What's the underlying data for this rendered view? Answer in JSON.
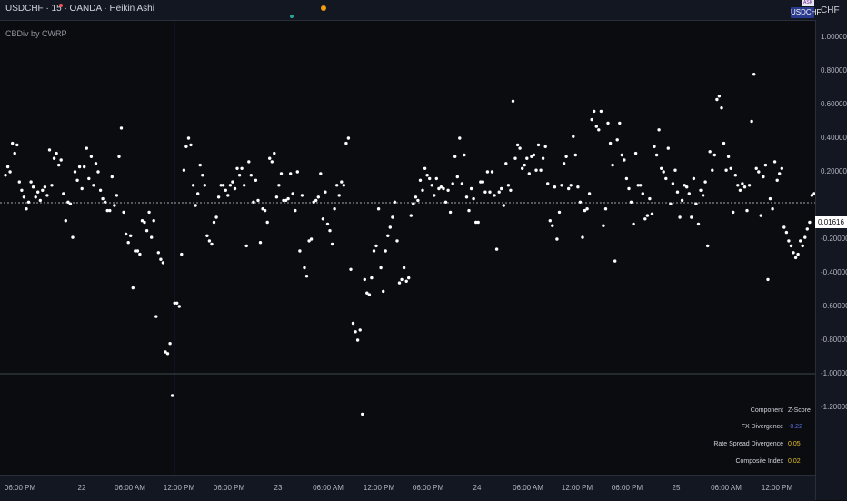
{
  "topbar": {
    "title": "USDCHF · 15 · OANDA · Heikin Ashi",
    "symbol_badge": "USDCHF",
    "ask_badge": "ASK",
    "currency": "CHF"
  },
  "indicator": {
    "name": "CBDiv by CWRP"
  },
  "colors": {
    "background": "#0b0c10",
    "points": "#ffffff",
    "negative_value": "#5b6ee1",
    "positive_value": "#e6c229",
    "accent_teal": "#26a69a",
    "accent_orange": "#f39c12"
  },
  "price_axis": {
    "ticks": [
      "1.00000",
      "0.80000",
      "0.60000",
      "0.40000",
      "0.20000",
      "-0.20000",
      "-0.40000",
      "-0.60000",
      "-0.80000",
      "-1.00000",
      "-1.20000"
    ],
    "current_value": "0.01616"
  },
  "time_axis": {
    "labels": [
      "06:00 PM",
      "22",
      "06:00 AM",
      "12:00 PM",
      "06:00 PM",
      "23",
      "06:00 AM",
      "12:00 PM",
      "06:00 PM",
      "24",
      "06:00 AM",
      "12:00 PM",
      "06:00 PM",
      "25",
      "06:00 AM",
      "12:00 PM"
    ]
  },
  "stats_table": {
    "header": [
      "Component",
      "Z-Score"
    ],
    "rows": [
      {
        "label": "FX Divergence",
        "value": "-0.22"
      },
      {
        "label": "Rate Spread Divergence",
        "value": "0.05"
      },
      {
        "label": "Composite Index",
        "value": "0.02"
      }
    ]
  },
  "chart_data": {
    "type": "scatter",
    "title": "",
    "xlabel": "",
    "ylabel": "",
    "ylim": [
      -1.3,
      1.05
    ],
    "reference_lines": [
      0.01616,
      -1.0
    ],
    "grid": false,
    "series": [
      {
        "values": [
          0.18,
          0.23,
          0.2,
          0.37,
          0.31,
          0.36,
          0.14,
          0.09,
          0.05,
          -0.02,
          0.02,
          0.14,
          0.11,
          0.05,
          0.08,
          0.03,
          0.09,
          0.11,
          0.06,
          0.33,
          0.12,
          0.28,
          0.31,
          0.24,
          0.27,
          0.07,
          -0.09,
          0.02,
          0.01,
          -0.19,
          0.2,
          0.15,
          0.23,
          0.1,
          0.23,
          0.34,
          0.16,
          0.29,
          0.12,
          0.25,
          0.2,
          0.09,
          0.04,
          0.02,
          -0.03,
          -0.03,
          0.17,
          0.0,
          0.06,
          0.29,
          0.46,
          -0.04,
          -0.17,
          -0.22,
          -0.18,
          -0.49,
          -0.27,
          -0.27,
          -0.29,
          -0.09,
          -0.1,
          -0.15,
          -0.04,
          -0.19,
          -0.09,
          -0.66,
          -0.28,
          -0.32,
          -0.34,
          -0.87,
          -0.88,
          -0.82,
          -1.13,
          -0.58,
          -0.58,
          -0.6,
          -0.29,
          0.21,
          0.35,
          0.4,
          0.36,
          0.12,
          0.0,
          0.07,
          0.24,
          0.18,
          0.12,
          -0.18,
          -0.21,
          -0.23,
          -0.1,
          -0.07,
          0.05,
          0.12,
          0.12,
          0.09,
          0.06,
          0.12,
          0.14,
          0.1,
          0.22,
          0.18,
          0.22,
          0.12,
          -0.24,
          0.26,
          0.18,
          0.02,
          0.15,
          0.03,
          -0.22,
          -0.02,
          -0.03,
          -0.1,
          0.28,
          0.26,
          0.31,
          0.05,
          0.12,
          0.19,
          0.03,
          0.03,
          0.04,
          0.19,
          0.07,
          -0.03,
          0.2,
          -0.27,
          0.06,
          -0.37,
          -0.42,
          -0.21,
          -0.2,
          0.02,
          0.03,
          0.05,
          0.19,
          -0.08,
          0.08,
          -0.11,
          -0.15,
          -0.23,
          -0.02,
          0.12,
          0.06,
          0.14,
          0.12,
          0.37,
          0.4,
          -0.38,
          -0.7,
          -0.75,
          -0.8,
          -0.74,
          -1.24,
          -0.44,
          -0.52,
          -0.53,
          -0.43,
          -0.27,
          -0.24,
          -0.02,
          -0.37,
          -0.51,
          -0.27,
          -0.18,
          -0.13,
          -0.07,
          0.02,
          -0.21,
          -0.46,
          -0.44,
          -0.37,
          -0.45,
          -0.43,
          -0.06,
          0.01,
          0.05,
          0.03,
          0.15,
          0.09,
          0.22,
          0.18,
          0.16,
          0.12,
          0.06,
          0.16,
          0.1,
          0.11,
          0.1,
          0.02,
          0.09,
          -0.04,
          0.13,
          0.29,
          0.17,
          0.4,
          0.13,
          0.3,
          0.05,
          -0.03,
          0.1,
          0.04,
          -0.1,
          -0.1,
          0.14,
          0.14,
          0.08,
          0.2,
          0.08,
          0.2,
          0.06,
          -0.26,
          0.08,
          0.1,
          0.0,
          0.25,
          0.12,
          0.09,
          0.62,
          0.28,
          0.36,
          0.34,
          0.22,
          0.24,
          0.28,
          0.19,
          0.29,
          0.3,
          0.21,
          0.36,
          0.21,
          0.28,
          0.35,
          0.13,
          -0.09,
          -0.12,
          0.11,
          -0.2,
          -0.04,
          0.12,
          0.25,
          0.29,
          0.1,
          0.12,
          0.41,
          0.3,
          0.11,
          0.02,
          -0.19,
          -0.03,
          -0.02,
          0.07,
          0.51,
          0.56,
          0.47,
          0.45,
          0.56,
          -0.12,
          -0.02,
          0.49,
          0.37,
          0.24,
          -0.33,
          0.39,
          0.49,
          0.3,
          0.27,
          0.16,
          0.1,
          0.02,
          -0.11,
          0.31,
          0.12,
          0.12,
          0.07,
          -0.08,
          -0.06,
          0.04,
          -0.05,
          0.35,
          0.3,
          0.45,
          0.22,
          0.2,
          0.16,
          0.34,
          0.01,
          0.13,
          0.21,
          0.08,
          -0.07,
          0.03,
          0.12,
          0.11,
          0.07,
          -0.07,
          0.16,
          0.01,
          -0.11,
          0.09,
          0.06,
          0.14,
          -0.24,
          0.32,
          0.21,
          0.3,
          0.63,
          0.65,
          0.58,
          0.37,
          0.21,
          0.29,
          0.22,
          -0.04,
          0.18,
          0.12,
          0.09,
          0.13,
          0.11,
          -0.03,
          0.12,
          0.5,
          0.78,
          0.22,
          0.2,
          -0.06,
          0.17,
          0.24,
          -0.44,
          0.04,
          -0.02,
          0.26,
          0.15,
          0.19,
          0.22,
          -0.13,
          -0.16,
          -0.21,
          -0.24,
          -0.28,
          -0.31,
          -0.29,
          -0.21,
          -0.24,
          -0.19,
          -0.14,
          -0.1,
          0.06,
          0.07
        ]
      }
    ]
  }
}
